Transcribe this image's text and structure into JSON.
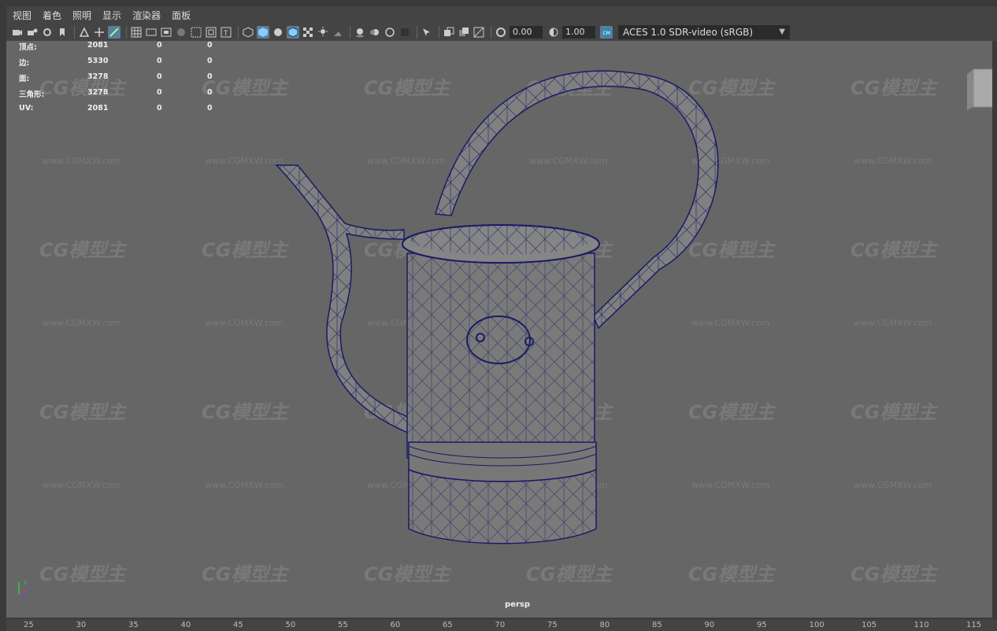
{
  "menu": [
    "视图",
    "着色",
    "照明",
    "显示",
    "渲染器",
    "面板"
  ],
  "toolbar": {
    "exposure": "0.00",
    "gamma": "1.00",
    "colorspace": "ACES 1.0 SDR-video (sRGB)"
  },
  "hud": {
    "rows": [
      {
        "label": "顶点:",
        "a": "2081",
        "b": "0",
        "c": "0"
      },
      {
        "label": "边:",
        "a": "5330",
        "b": "0",
        "c": "0"
      },
      {
        "label": "面:",
        "a": "3278",
        "b": "0",
        "c": "0"
      },
      {
        "label": "三角形:",
        "a": "3278",
        "b": "0",
        "c": "0"
      },
      {
        "label": "UV:",
        "a": "2081",
        "b": "0",
        "c": "0"
      }
    ]
  },
  "camera_label": "persp",
  "watermark": {
    "logo": "CG模型主",
    "url": "www.CGMXW.com"
  },
  "ruler": [
    "25",
    "30",
    "35",
    "40",
    "45",
    "50",
    "55",
    "60",
    "65",
    "70",
    "75",
    "80",
    "85",
    "90",
    "95",
    "100",
    "105",
    "110",
    "115"
  ],
  "colors": {
    "wire": "#1a1a66",
    "viewport": "#666666",
    "highlight": "#5d7d9a"
  }
}
